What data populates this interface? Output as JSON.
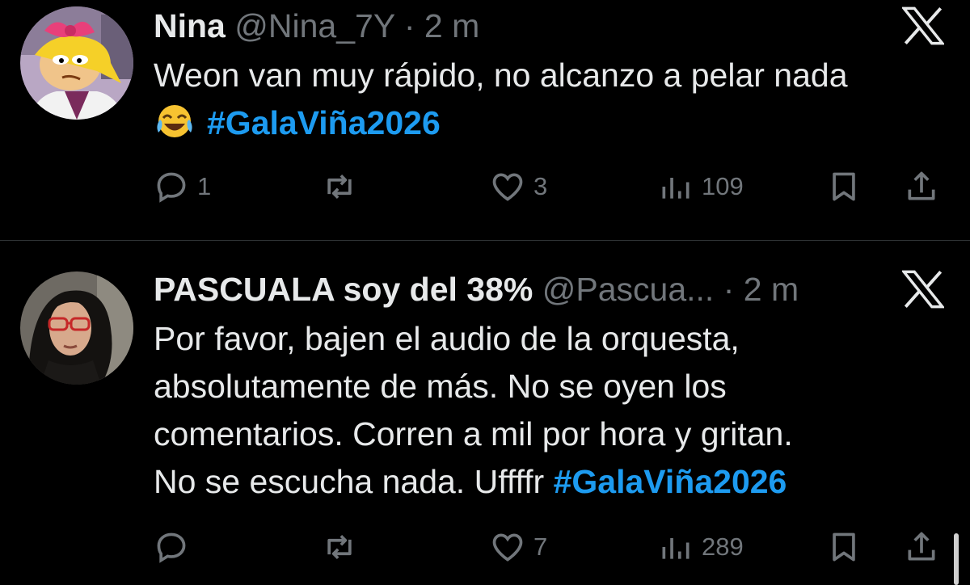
{
  "tweets": [
    {
      "name": "Nina",
      "handle": "@Nina_7Y",
      "separator": "·",
      "time": "2 m",
      "text_lines": [
        "Weon van muy rápido, no alcanzo a pelar nada"
      ],
      "trailing_emoji": "face-with-tears-of-joy",
      "hashtag": "#GalaViña2026",
      "replies": "1",
      "retweets": "",
      "likes": "3",
      "views": "109"
    },
    {
      "name": "PASCUALA soy del 38%",
      "handle": "@Pascua...",
      "separator": "·",
      "time": "2 m",
      "text_lines": [
        "Por favor, bajen el audio de la orquesta,",
        "absolutamente de más. No se oyen los",
        "comentarios. Corren a mil por hora y gritan.",
        "No se escucha nada. Uffffr"
      ],
      "hashtag": "#GalaViña2026",
      "replies": "",
      "retweets": "",
      "likes": "7",
      "views": "289"
    }
  ],
  "colors": {
    "background": "#000000",
    "text": "#e7e9ea",
    "muted": "#71767b",
    "hashtag": "#1d9bf0",
    "divider": "#2f3336"
  },
  "icons": {
    "reply": "reply-icon",
    "retweet": "retweet-icon",
    "like": "heart-icon",
    "views": "views-icon",
    "bookmark": "bookmark-icon",
    "share": "share-icon",
    "brand": "x-logo-icon"
  }
}
